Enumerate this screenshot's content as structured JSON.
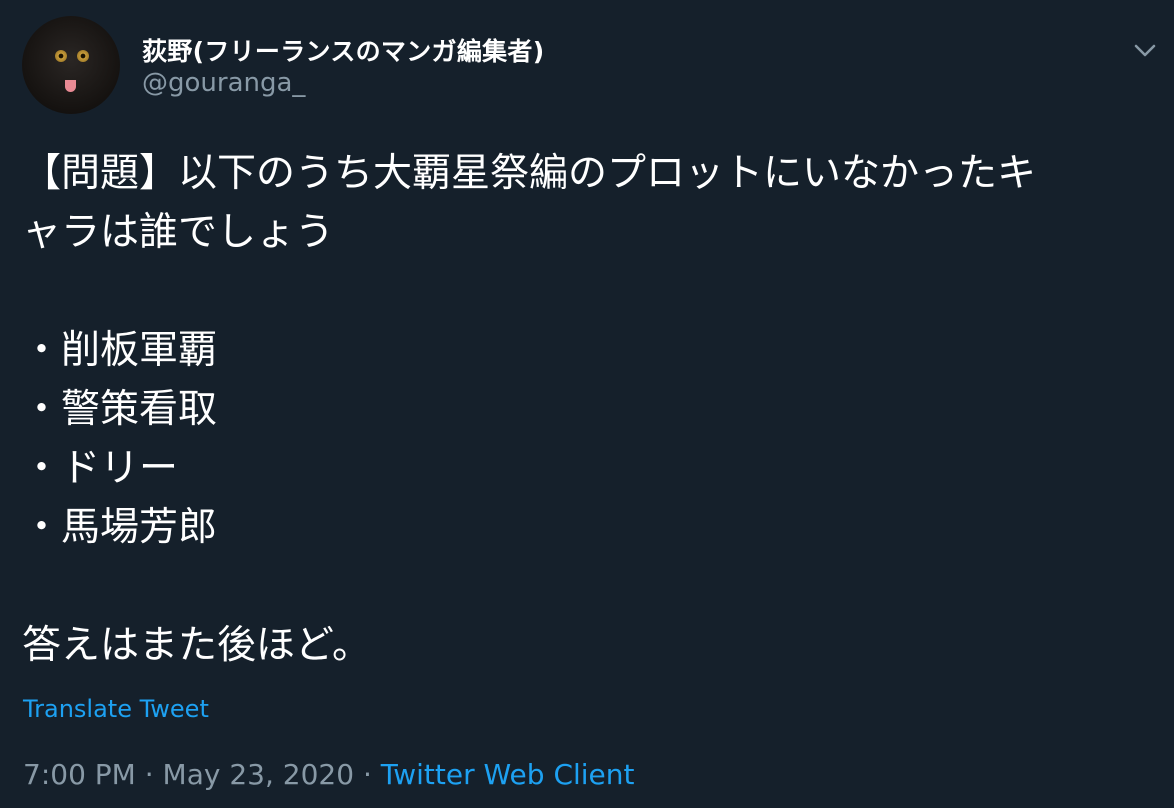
{
  "tweet": {
    "author": {
      "display_name": "荻野(フリーランスのマンガ編集者)",
      "handle": "@gouranga_"
    },
    "text_lines": {
      "line1": "【問題】以下のうち大覇星祭編のプロットにいなかったキ",
      "line2": "ャラは誰でしょう",
      "item1": "・削板軍覇",
      "item2": "・警策看取",
      "item3": "・ドリー",
      "item4": "・馬場芳郎",
      "closing": "答えはまた後ほど。"
    },
    "translate_label": "Translate Tweet",
    "time": "7:00 PM",
    "separator": "·",
    "date": "May 23, 2020",
    "client": "Twitter Web Client"
  },
  "colors": {
    "background": "#15202b",
    "text": "#ffffff",
    "secondary": "#8899a6",
    "accent": "#1da1f2"
  },
  "icons": {
    "menu": "chevron-down-icon"
  }
}
